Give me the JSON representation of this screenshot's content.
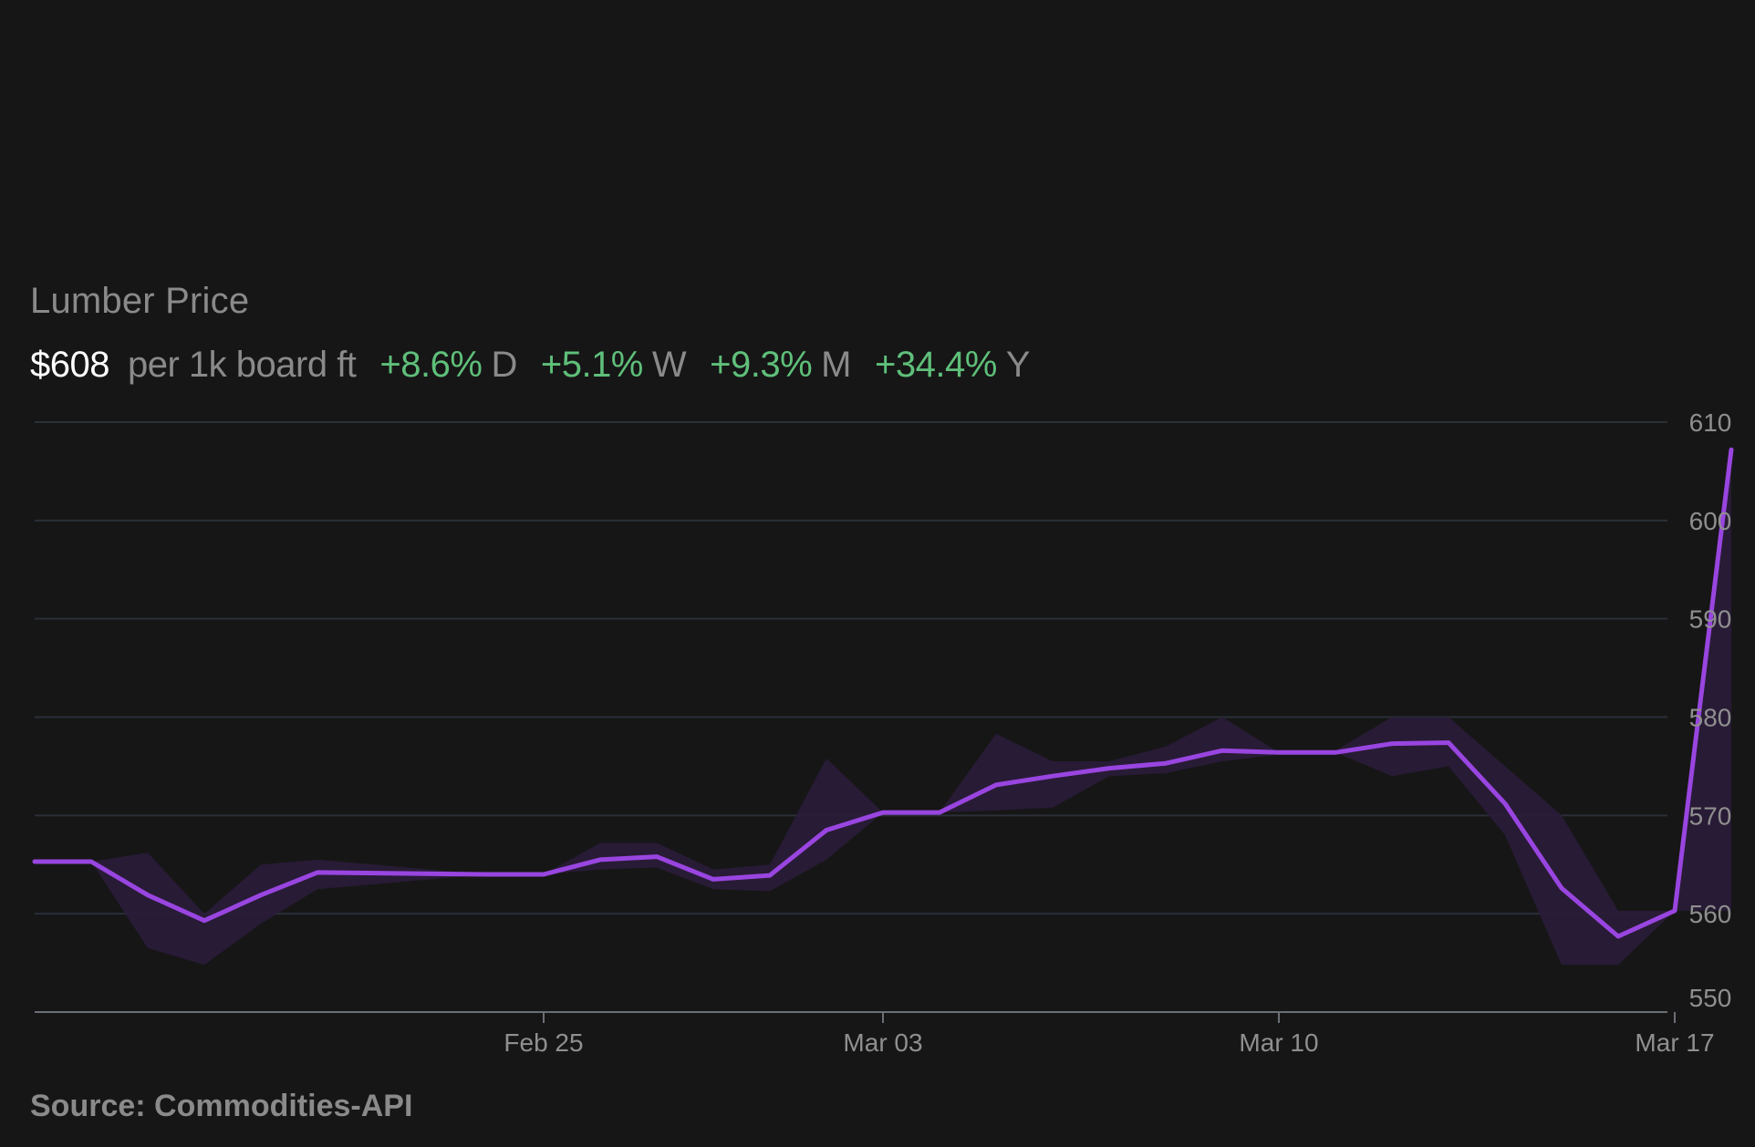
{
  "header": {
    "title": "Lumber Price",
    "price": "$608",
    "unit": "per 1k board ft",
    "changes": [
      {
        "value": "+8.6%",
        "period": "D"
      },
      {
        "value": "+5.1%",
        "period": "W"
      },
      {
        "value": "+9.3%",
        "period": "M"
      },
      {
        "value": "+34.4%",
        "period": "Y"
      }
    ]
  },
  "source": "Source: Commodities-API",
  "colors": {
    "background": "#161616",
    "line": "#9945e0",
    "band": "#2a1c3a",
    "positive": "#5fbf7a",
    "muted": "#8a8a8a",
    "grid": "#2a2f38"
  },
  "chart_data": {
    "type": "line",
    "series": [
      {
        "x": [
          "2025-02-16",
          "2025-02-17",
          "2025-02-18",
          "2025-02-19",
          "2025-02-20",
          "2025-02-21",
          "2025-02-24",
          "2025-02-25",
          "2025-02-26",
          "2025-02-27",
          "2025-02-28",
          "2025-03-01",
          "2025-03-02",
          "2025-03-03",
          "2025-03-04",
          "2025-03-05",
          "2025-03-06",
          "2025-03-07",
          "2025-03-08",
          "2025-03-09",
          "2025-03-10",
          "2025-03-11",
          "2025-03-12",
          "2025-03-13",
          "2025-03-14",
          "2025-03-15",
          "2025-03-16",
          "2025-03-17",
          "2025-03-18"
        ],
        "values": [
          565.3,
          565.3,
          561.9,
          559.3,
          561.9,
          564.2,
          564.0,
          564.0,
          565.5,
          565.8,
          563.5,
          563.9,
          568.5,
          570.3,
          570.3,
          573.1,
          574.0,
          574.8,
          575.3,
          576.6,
          576.4,
          576.4,
          577.3,
          577.4,
          571.2,
          562.6,
          557.7,
          560.3,
          607.2
        ],
        "band_low": [
          565.3,
          565.3,
          556.5,
          554.8,
          559.0,
          562.5,
          564.0,
          564.0,
          564.5,
          564.7,
          562.5,
          562.3,
          565.5,
          570.3,
          570.3,
          570.5,
          570.8,
          574.0,
          574.3,
          575.5,
          576.2,
          576.4,
          574.0,
          575.0,
          568.0,
          554.8,
          554.8,
          560.3,
          560.3
        ],
        "band_high": [
          565.3,
          565.3,
          566.2,
          560.0,
          565.0,
          565.5,
          564.0,
          564.0,
          567.2,
          567.2,
          564.5,
          565.0,
          575.8,
          570.3,
          570.3,
          578.3,
          575.5,
          575.5,
          577.0,
          580.0,
          576.4,
          576.6,
          580.0,
          580.0,
          575.0,
          570.0,
          560.3,
          560.3,
          607.2
        ]
      }
    ],
    "x_tick_labels": [
      "Feb 25",
      "Mar 03",
      "Mar 10",
      "Mar 17"
    ],
    "x_tick_dates": [
      "2025-02-25",
      "2025-03-03",
      "2025-03-10",
      "2025-03-17"
    ],
    "y_ticks": [
      550,
      560,
      570,
      580,
      590,
      600,
      610
    ],
    "ylim": [
      550,
      610
    ],
    "xlabel": "",
    "ylabel": "",
    "grid": true,
    "y_axis_side": "right"
  }
}
